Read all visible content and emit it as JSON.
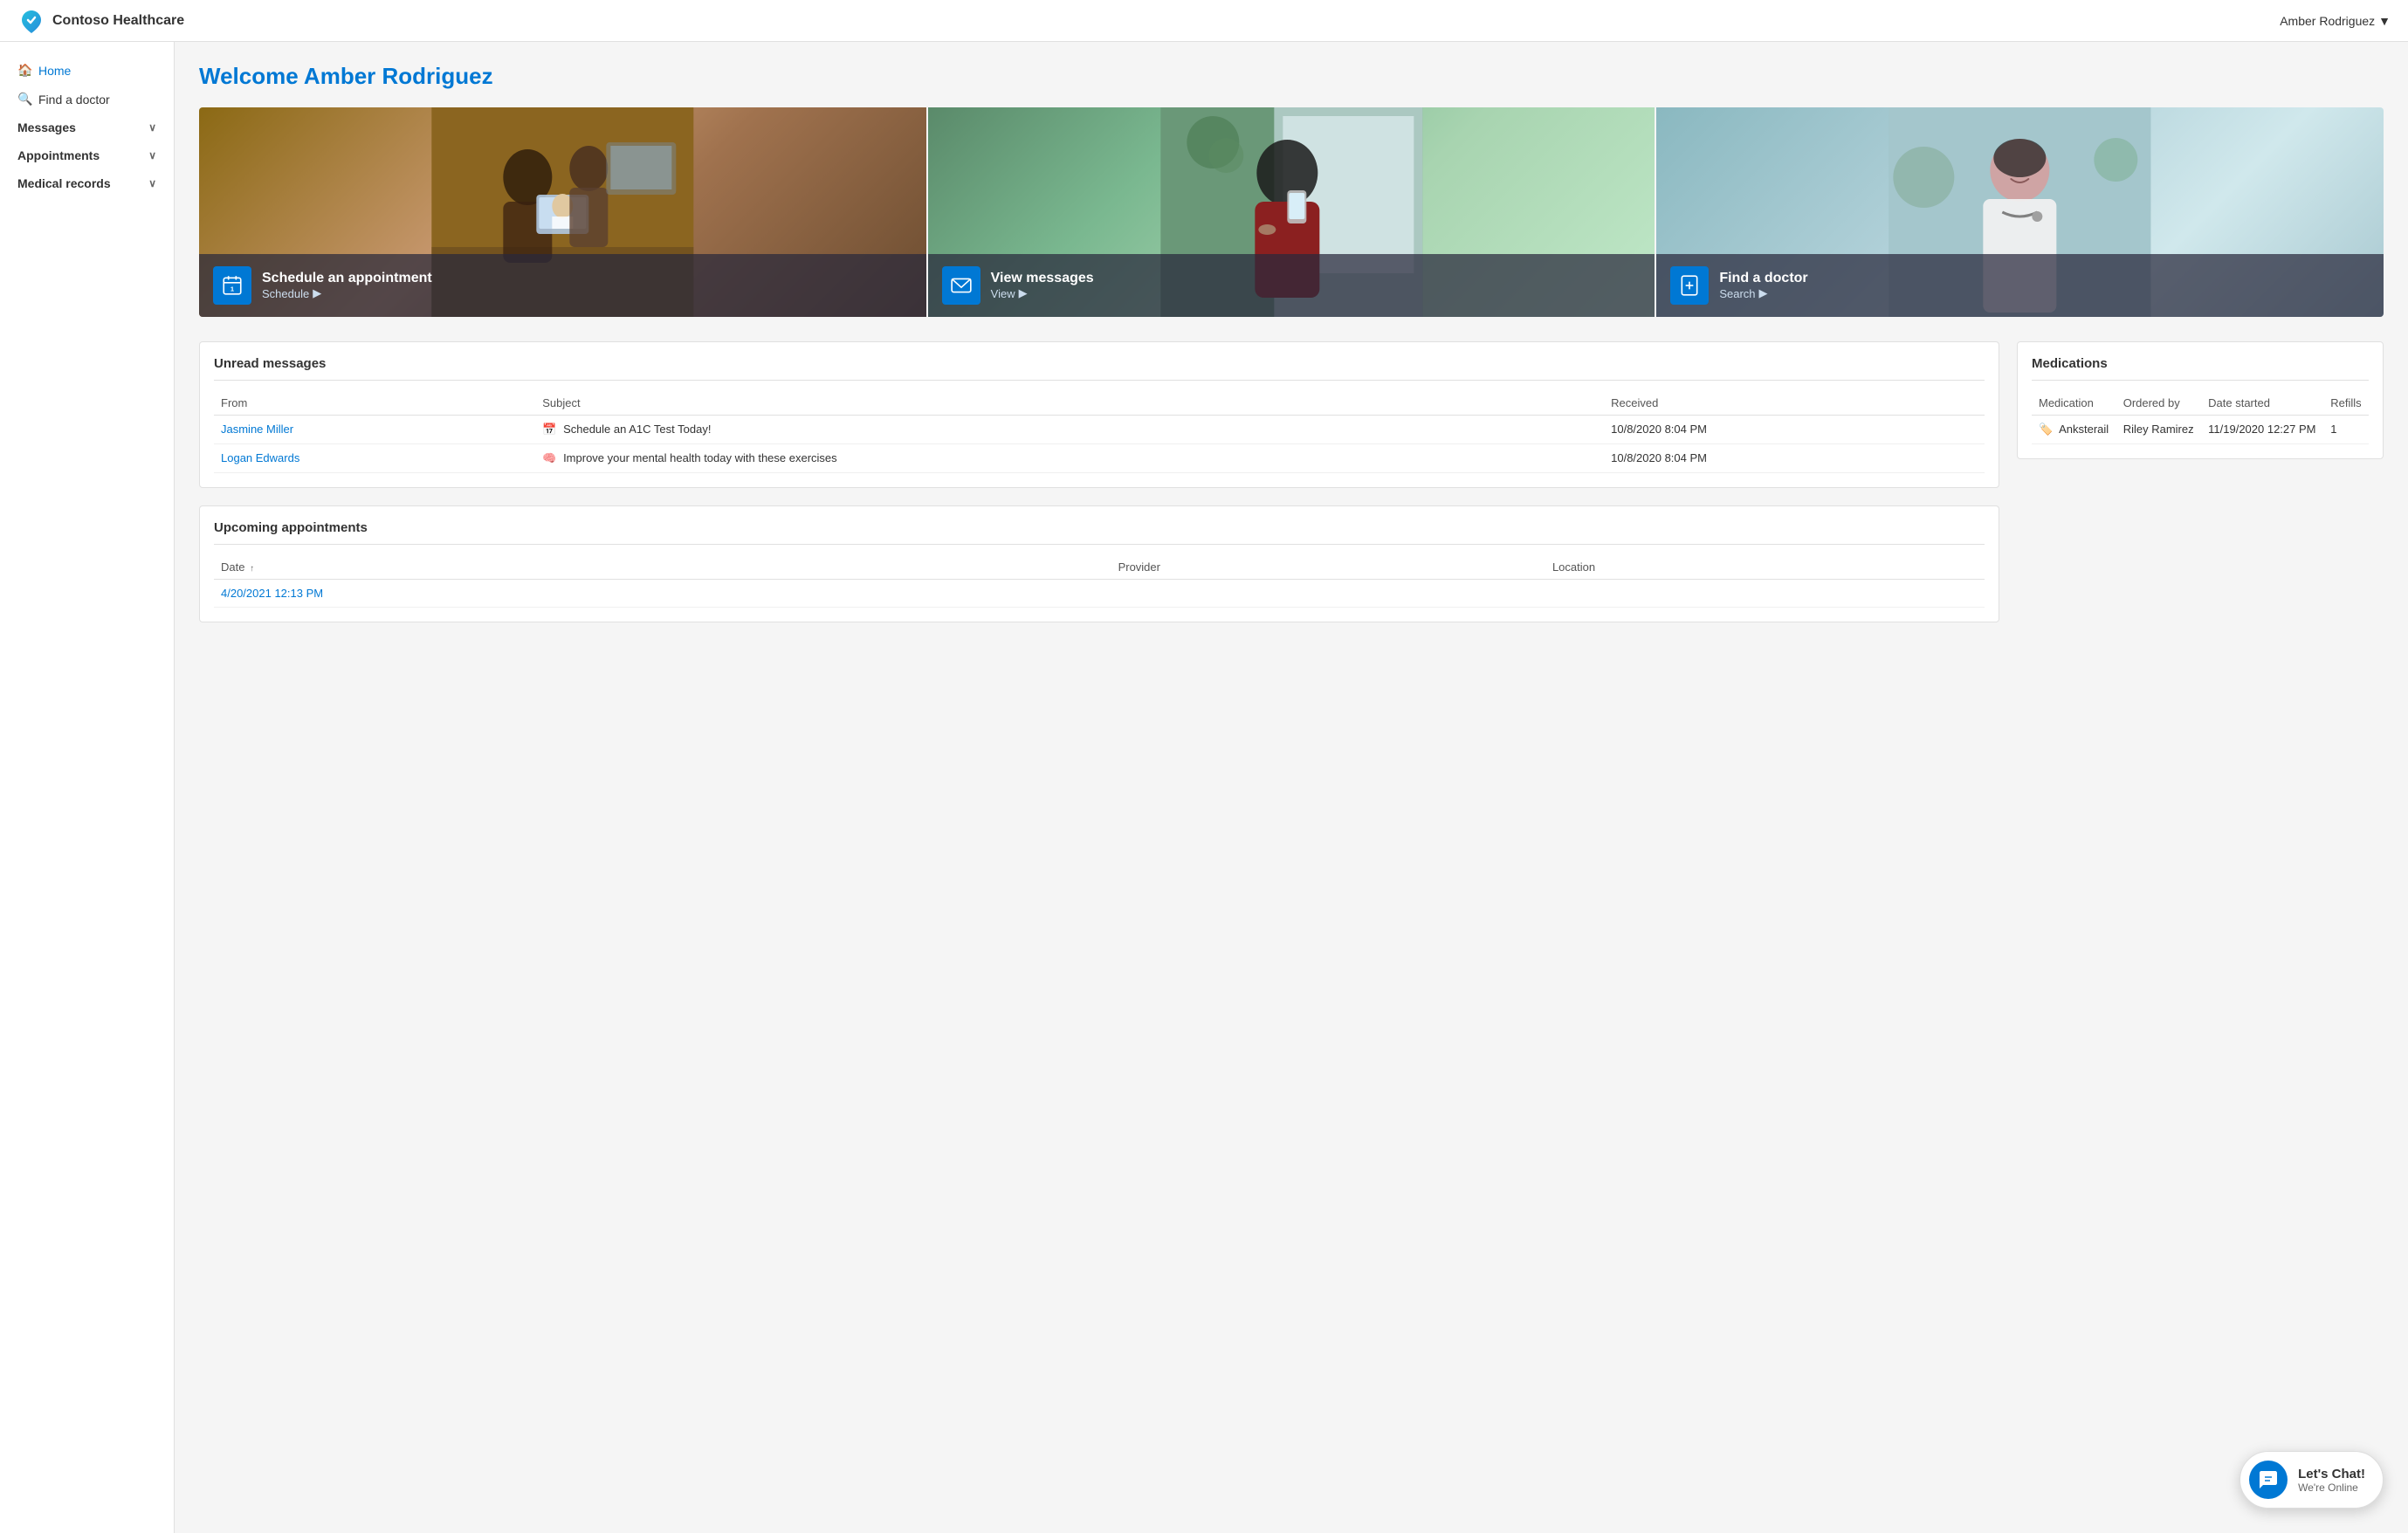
{
  "header": {
    "brand_name": "Contoso Healthcare",
    "user_name": "Amber Rodriguez",
    "user_chevron": "▼"
  },
  "sidebar": {
    "items": [
      {
        "id": "home",
        "label": "Home",
        "icon": "🏠"
      },
      {
        "id": "find-doctor",
        "label": "Find a doctor",
        "icon": "🔍"
      }
    ],
    "nav_groups": [
      {
        "id": "messages",
        "label": "Messages"
      },
      {
        "id": "appointments",
        "label": "Appointments"
      },
      {
        "id": "medical-records",
        "label": "Medical records"
      }
    ]
  },
  "main": {
    "welcome_title": "Welcome Amber Rodriguez",
    "hero_cards": [
      {
        "id": "schedule",
        "title": "Schedule an appointment",
        "action": "Schedule",
        "action_arrow": "▶"
      },
      {
        "id": "messages",
        "title": "View messages",
        "action": "View",
        "action_arrow": "▶"
      },
      {
        "id": "find-doctor",
        "title": "Find a doctor",
        "action": "Search",
        "action_arrow": "▶"
      }
    ],
    "unread_messages": {
      "title": "Unread messages",
      "columns": [
        "From",
        "Subject",
        "Received"
      ],
      "rows": [
        {
          "from": "Jasmine Miller",
          "subject_icon": "📅",
          "subject": "Schedule an A1C Test Today!",
          "received": "10/8/2020 8:04 PM"
        },
        {
          "from": "Logan Edwards",
          "subject_icon": "🧠",
          "subject": "Improve your mental health today with these exercises",
          "received": "10/8/2020 8:04 PM"
        }
      ]
    },
    "upcoming_appointments": {
      "title": "Upcoming appointments",
      "columns": [
        {
          "label": "Date",
          "sort": "↑"
        },
        {
          "label": "Provider",
          "sort": ""
        },
        {
          "label": "Location",
          "sort": ""
        }
      ],
      "rows": [
        {
          "date": "4/20/2021 12:13 PM",
          "provider": "",
          "location": ""
        }
      ]
    },
    "medications": {
      "title": "Medications",
      "columns": [
        "Medication",
        "Ordered by",
        "Date started",
        "Refills"
      ],
      "rows": [
        {
          "medication_icon": "🏷️",
          "medication": "Anksterail",
          "ordered_by": "Riley Ramirez",
          "date_started": "11/19/2020 12:27 PM",
          "refills": "1"
        }
      ]
    }
  },
  "chat": {
    "main_label": "Let's Chat!",
    "sub_label": "We're Online"
  }
}
